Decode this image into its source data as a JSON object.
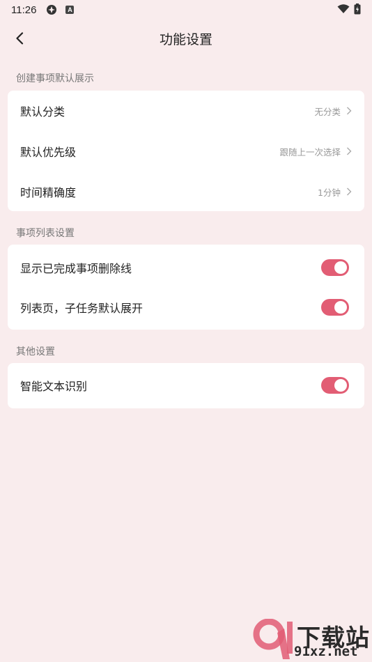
{
  "status_bar": {
    "time": "11:26",
    "a_icon_label": "A"
  },
  "header": {
    "title": "功能设置"
  },
  "sections": [
    {
      "label": "创建事项默认展示",
      "items": [
        {
          "label": "默认分类",
          "value": "无分类"
        },
        {
          "label": "默认优先级",
          "value": "跟随上一次选择"
        },
        {
          "label": "时间精确度",
          "value": "1分钟"
        }
      ]
    },
    {
      "label": "事项列表设置",
      "items": [
        {
          "label": "显示已完成事项删除线",
          "toggle_on": true
        },
        {
          "label": "列表页，子任务默认展开",
          "toggle_on": true
        }
      ]
    },
    {
      "label": "其他设置",
      "items": [
        {
          "label": "智能文本识别",
          "toggle_on": true
        }
      ]
    }
  ],
  "watermark": {
    "title": "下载站",
    "url": "91xz.net"
  },
  "colors": {
    "background": "#f9eced",
    "accent": "#e25d74",
    "card": "#ffffff"
  }
}
